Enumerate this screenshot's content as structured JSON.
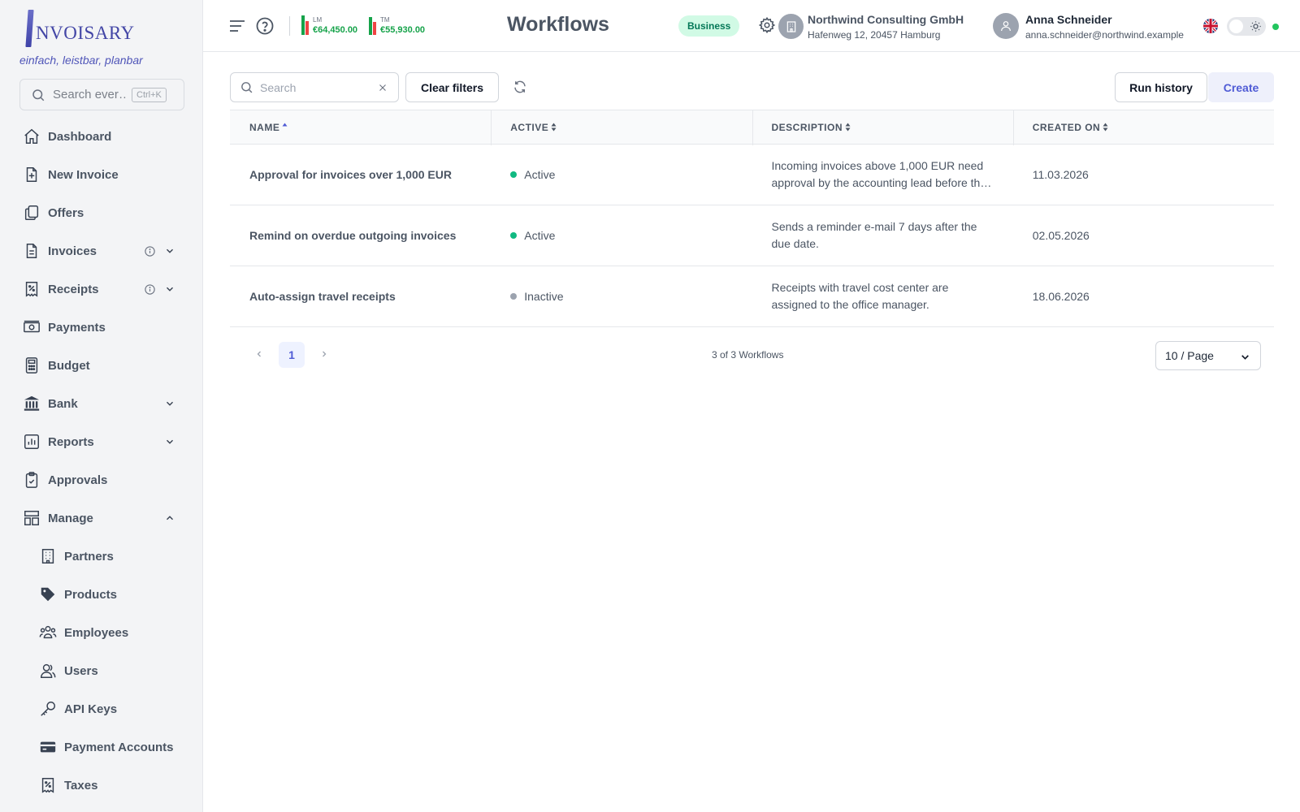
{
  "brand": {
    "logo_text": "NVOISARY",
    "tagline": "einfach, leistbar, planbar"
  },
  "sidebar": {
    "search": {
      "placeholder": "Search ever…",
      "shortcut": "Ctrl+K"
    },
    "items": [
      {
        "label": "Dashboard",
        "icon": "home-icon"
      },
      {
        "label": "New Invoice",
        "icon": "file-plus-icon"
      },
      {
        "label": "Offers",
        "icon": "copy-icon"
      },
      {
        "label": "Invoices",
        "icon": "file-text-icon",
        "info": true,
        "expandable": true
      },
      {
        "label": "Receipts",
        "icon": "receipt-percent-icon",
        "info": true,
        "expandable": true
      },
      {
        "label": "Payments",
        "icon": "banknote-icon"
      },
      {
        "label": "Budget",
        "icon": "calculator-icon"
      },
      {
        "label": "Bank",
        "icon": "bank-icon",
        "expandable": true
      },
      {
        "label": "Reports",
        "icon": "bar-chart-icon",
        "expandable": true
      },
      {
        "label": "Approvals",
        "icon": "clipboard-check-icon"
      },
      {
        "label": "Manage",
        "icon": "layout-icon",
        "expanded": true
      }
    ],
    "manage_items": [
      {
        "label": "Partners",
        "icon": "building-icon"
      },
      {
        "label": "Products",
        "icon": "tag-icon"
      },
      {
        "label": "Employees",
        "icon": "users-group-icon"
      },
      {
        "label": "Users",
        "icon": "users-icon"
      },
      {
        "label": "API Keys",
        "icon": "key-icon"
      },
      {
        "label": "Payment Accounts",
        "icon": "credit-card-icon"
      },
      {
        "label": "Taxes",
        "icon": "receipt-percent-icon"
      }
    ]
  },
  "header": {
    "title": "Workflows",
    "kpis": [
      {
        "label": "LM",
        "value": "€64,450.00"
      },
      {
        "label": "TM",
        "value": "€55,930.00"
      }
    ],
    "plan_badge": "Business",
    "company": {
      "name": "Northwind Consulting GmbH",
      "address": "Hafenweg 12, 20457 Hamburg"
    },
    "user": {
      "name": "Anna Schneider",
      "email": "anna.schneider@northwind.example"
    },
    "colors": {
      "accent": "#4f5bd5",
      "success": "#22c55e",
      "kpi_green": "#16a34a",
      "kpi_red": "#ef4444"
    }
  },
  "toolbar": {
    "search_placeholder": "Search",
    "search_value": "",
    "clear_filters": "Clear filters",
    "run_history": "Run history",
    "create": "Create"
  },
  "table": {
    "columns": [
      "NAME",
      "ACTIVE",
      "DESCRIPTION",
      "CREATED ON"
    ],
    "sort": {
      "column": "NAME",
      "direction": "asc"
    },
    "rows": [
      {
        "name": "Approval for invoices over 1,000 EUR",
        "status": "Active",
        "status_color": "#10b981",
        "description_lines": [
          "Incoming invoices above 1,000 EUR need",
          "approval by the accounting lead before th…"
        ],
        "created_on": "11.03.2026"
      },
      {
        "name": "Remind on overdue outgoing invoices",
        "status": "Active",
        "status_color": "#10b981",
        "description_lines": [
          "Sends a reminder e-mail 7 days after the",
          "due date."
        ],
        "created_on": "02.05.2026"
      },
      {
        "name": "Auto-assign travel receipts",
        "status": "Inactive",
        "status_color": "#9ca3af",
        "description_lines": [
          "Receipts with travel cost center are",
          "assigned to the office manager."
        ],
        "created_on": "18.06.2026"
      }
    ]
  },
  "pagination": {
    "current_page": "1",
    "total_text": "3 of 3 Workflows",
    "page_size": "10 / Page"
  }
}
